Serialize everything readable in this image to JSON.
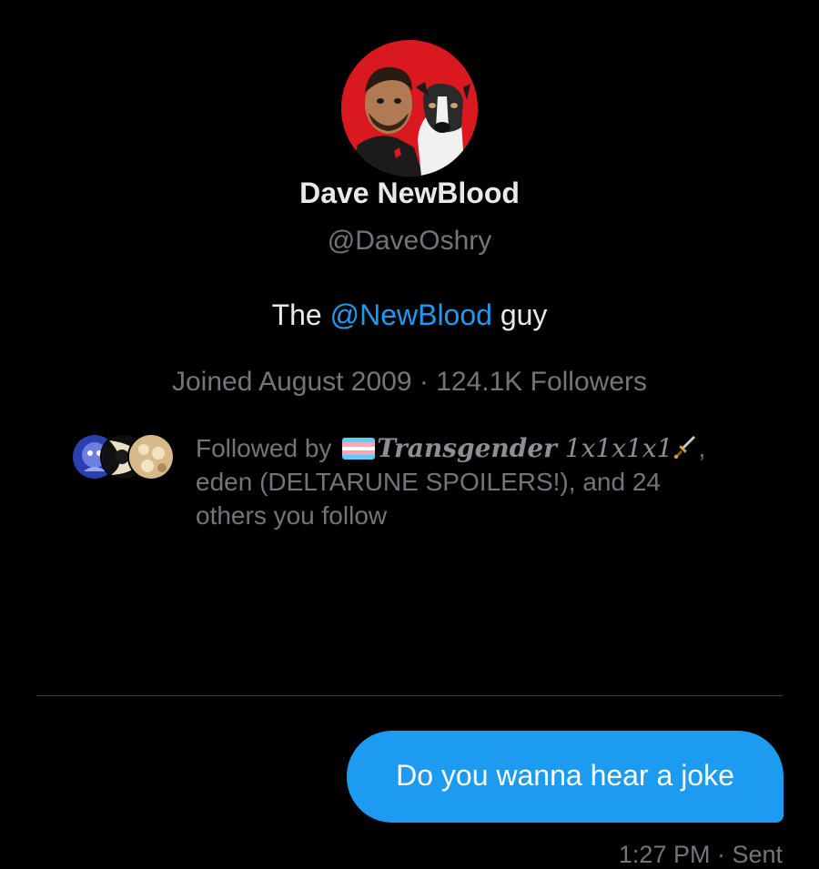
{
  "profile": {
    "avatar_icon": "profile-avatar-man-with-dog",
    "display_name": "Dave NewBlood",
    "handle": "@DaveOshry",
    "bio_prefix": "The ",
    "bio_mention": "@NewBlood",
    "bio_suffix": " guy",
    "joined": "Joined August 2009",
    "separator": " · ",
    "followers": "124.1K Followers"
  },
  "followed_by": {
    "prefix": "Followed by ",
    "flag_icon": "transgender-flag-icon",
    "name_word": "Transgender",
    "name_suffix": " 1x1x1x1",
    "dagger_icon": "dagger-icon",
    "line2": ", ",
    "line3": "eden (DELTARUNE SPOILERS!), and 24",
    "line4": "others you follow"
  },
  "conversation": {
    "message_text": "Do you wanna hear a joke",
    "timestamp": "1:27 PM · Sent"
  },
  "colors": {
    "background": "#000000",
    "primary_text": "#e7e9ea",
    "secondary_text": "#71767b",
    "accent": "#1d9bf0",
    "avatar_bg": "#d9181f"
  }
}
